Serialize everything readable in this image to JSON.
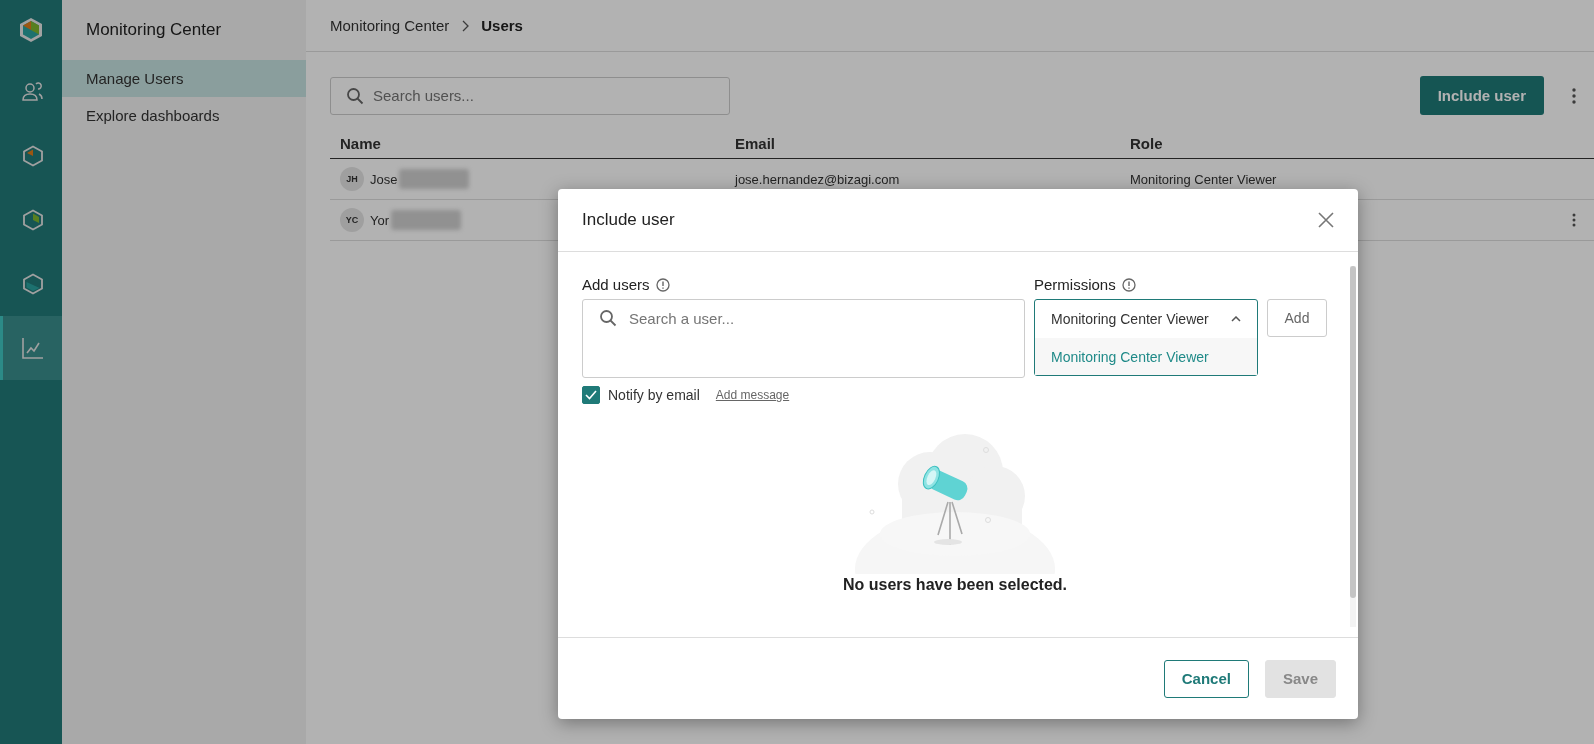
{
  "rail": {
    "items": [
      {
        "kind": "users",
        "selected": false
      },
      {
        "kind": "hex-orange",
        "selected": false
      },
      {
        "kind": "hex-green",
        "selected": false
      },
      {
        "kind": "hex-teal",
        "selected": false
      },
      {
        "kind": "chart",
        "selected": true
      }
    ]
  },
  "sidebar": {
    "title": "Monitoring Center",
    "items": [
      {
        "label": "Manage Users",
        "selected": true
      },
      {
        "label": "Explore dashboards",
        "selected": false
      }
    ]
  },
  "breadcrumb": [
    {
      "label": "Monitoring Center",
      "current": false
    },
    {
      "label": "Users",
      "current": true
    }
  ],
  "search": {
    "placeholder": "Search users..."
  },
  "include_button": "Include user",
  "table": {
    "columns": [
      "Name",
      "Email",
      "Role"
    ],
    "rows": [
      {
        "initials": "JH",
        "name": "Jose",
        "email": "jose.hernandez@bizagi.com",
        "role": "Monitoring Center Viewer",
        "menu": false
      },
      {
        "initials": "YC",
        "name": "Yor",
        "menu": true
      }
    ]
  },
  "dialog": {
    "title": "Include user",
    "add_users": {
      "label": "Add users",
      "placeholder": "Search a user..."
    },
    "permissions": {
      "label": "Permissions",
      "value": "Monitoring Center Viewer",
      "expanded": true,
      "options": [
        {
          "label": "Monitoring Center Viewer",
          "selected": true
        }
      ]
    },
    "add_button": "Add",
    "notify": {
      "label": "Notify by email",
      "checked": true
    },
    "add_message": "Add message",
    "empty_text": "No users have been selected.",
    "buttons": [
      {
        "label": "Cancel",
        "kind": "secondary",
        "disabled": false
      },
      {
        "label": "Save",
        "kind": "primary",
        "disabled": true
      }
    ]
  }
}
